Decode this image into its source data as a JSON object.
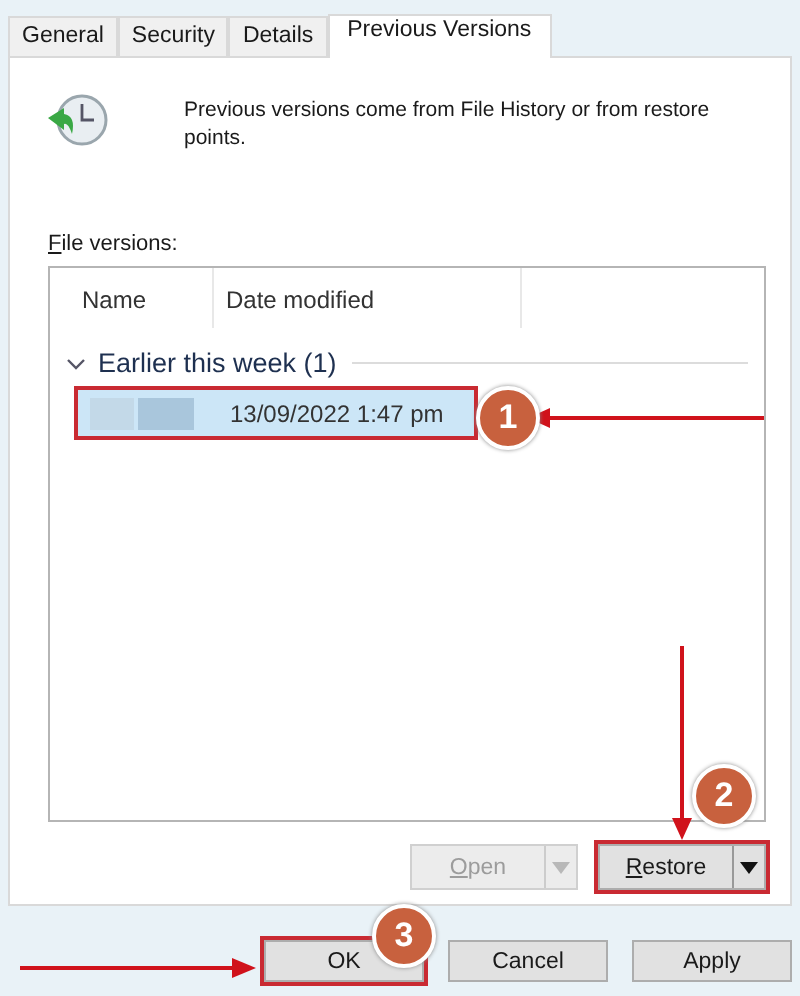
{
  "tabs": [
    {
      "label": "General",
      "selected": false
    },
    {
      "label": "Security",
      "selected": false
    },
    {
      "label": "Details",
      "selected": false
    },
    {
      "label": "Previous Versions",
      "selected": true
    }
  ],
  "description": "Previous versions come from File History or from restore points.",
  "file_versions": {
    "label": "File versions:",
    "columns": [
      "Name",
      "Date modified"
    ],
    "groups": [
      {
        "label": "Earlier this week (1)",
        "expanded": true,
        "rows": [
          {
            "date": "13/09/2022 1:47 pm",
            "selected": true
          }
        ]
      }
    ]
  },
  "action_buttons": [
    {
      "label": "Open",
      "disabled": true
    },
    {
      "label": "Restore",
      "disabled": false
    }
  ],
  "dialog_buttons": [
    {
      "label": "OK"
    },
    {
      "label": "Cancel"
    },
    {
      "label": "Apply"
    }
  ],
  "callouts": [
    "1",
    "2",
    "3"
  ]
}
